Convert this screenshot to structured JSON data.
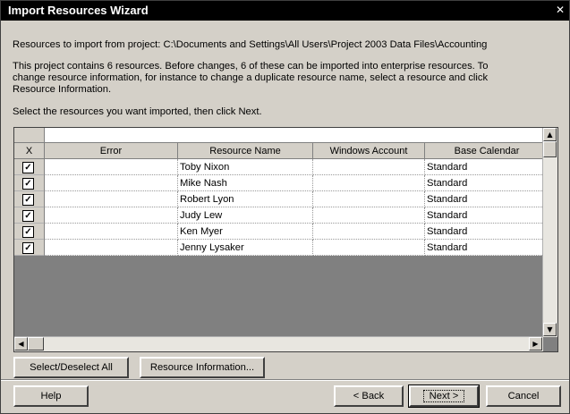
{
  "window": {
    "title": "Import Resources Wizard",
    "close_glyph": "✕"
  },
  "text": {
    "project_line": "Resources to import from project: C:\\Documents and Settings\\All Users\\Project 2003 Data Files\\Accounting",
    "info_line1": "This project contains 6 resources. Before changes, 6 of these can be imported into enterprise resources. To",
    "info_line2": "change resource information, for instance to change a duplicate resource name, select a resource and click",
    "info_line3": "Resource Information.",
    "instruction": "Select the resources you want imported, then click Next."
  },
  "grid": {
    "columns": [
      "X",
      "Error",
      "Resource Name",
      "Windows Account",
      "Base Calendar"
    ],
    "rows": [
      {
        "checked": true,
        "error": "",
        "name": "Toby Nixon",
        "account": "",
        "calendar": "Standard"
      },
      {
        "checked": true,
        "error": "",
        "name": "Mike Nash",
        "account": "",
        "calendar": "Standard"
      },
      {
        "checked": true,
        "error": "",
        "name": "Robert Lyon",
        "account": "",
        "calendar": "Standard"
      },
      {
        "checked": true,
        "error": "",
        "name": "Judy Lew",
        "account": "",
        "calendar": "Standard"
      },
      {
        "checked": true,
        "error": "",
        "name": "Ken Myer",
        "account": "",
        "calendar": "Standard"
      },
      {
        "checked": true,
        "error": "",
        "name": "Jenny Lysaker",
        "account": "",
        "calendar": "Standard"
      }
    ],
    "check_glyph": "✓"
  },
  "buttons": {
    "select_all": "Select/Deselect All",
    "resource_info": "Resource Information...",
    "help": "Help",
    "back": "< Back",
    "next": "Next >",
    "cancel": "Cancel"
  },
  "scroll_glyphs": {
    "up": "▲",
    "down": "▼",
    "left": "◀",
    "right": "▶"
  }
}
